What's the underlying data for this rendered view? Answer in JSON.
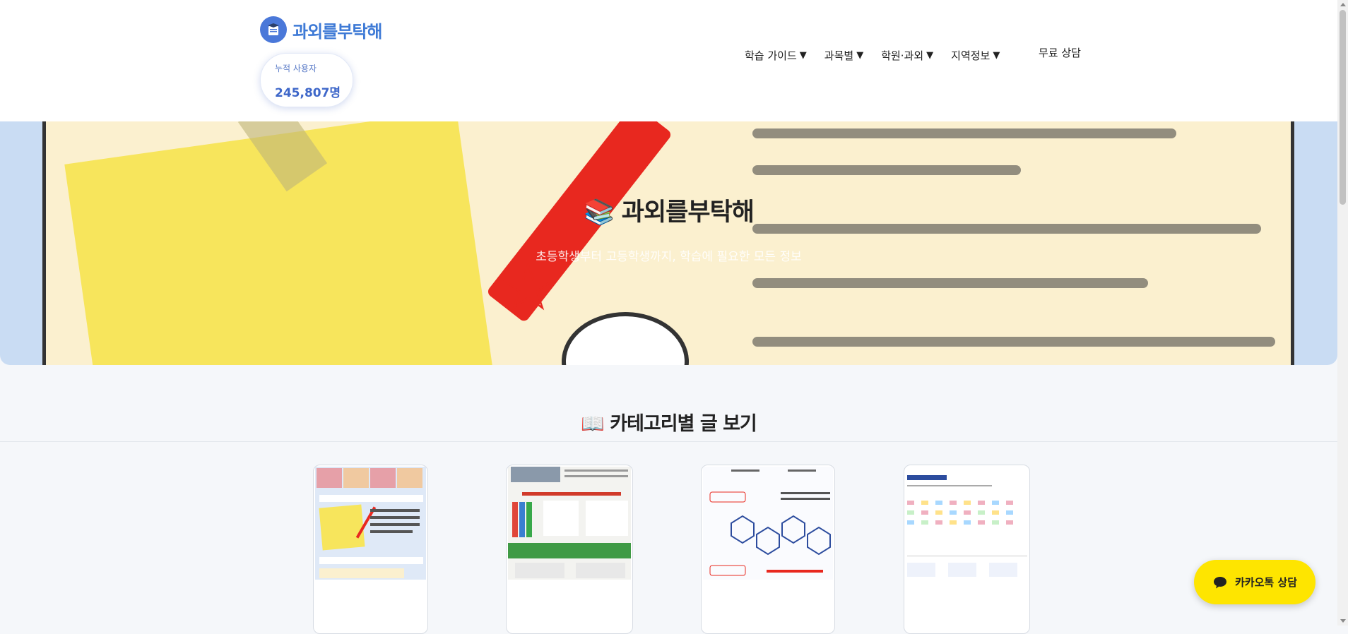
{
  "header": {
    "logo_text": "과외를부탁해",
    "user_counter": {
      "label": "누적 사용자",
      "value": "245,807명"
    },
    "nav": [
      {
        "label": "학습 가이드",
        "arrow": "▼"
      },
      {
        "label": "과목별",
        "arrow": "▼"
      },
      {
        "label": "학원·과외",
        "arrow": "▼"
      },
      {
        "label": "지역정보",
        "arrow": "▼"
      }
    ],
    "consult_label": "무료 상담"
  },
  "hero": {
    "title": "📚 과외를부탁해",
    "subtitle": "초등학생부터 고등학생까지, 학습에 필요한 모든 정보"
  },
  "category": {
    "heading": "📖 카테고리별 글 보기"
  },
  "kakao": {
    "label": "카카오톡 상담",
    "icon": "chat-bubble-icon",
    "color": "#FEE500"
  },
  "colors": {
    "brand": "#3E7AD6",
    "hero_bg": "#C9DCF3"
  }
}
